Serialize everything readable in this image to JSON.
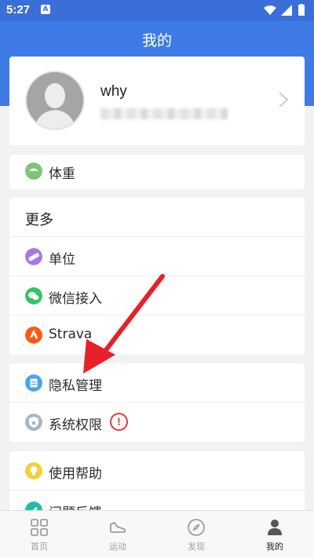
{
  "status_bar": {
    "time": "5:27",
    "notif_letter": "A"
  },
  "header": {
    "title": "我的"
  },
  "profile": {
    "username": "why",
    "avatar_icon": "avatar-placeholder-icon"
  },
  "weight_section": {
    "label": "体重",
    "icon": "scale-icon",
    "icon_color": "#7cc576"
  },
  "more_section": {
    "title": "更多",
    "items": [
      {
        "label": "单位",
        "icon": "ruler-icon",
        "icon_color": "#a678e6"
      },
      {
        "label": "微信接入",
        "icon": "wechat-icon",
        "icon_color": "#35c45f"
      },
      {
        "label": "Strava",
        "icon": "strava-icon",
        "icon_color": "#fc5a12"
      }
    ]
  },
  "privacy_section": {
    "items": [
      {
        "label": "隐私管理",
        "icon": "document-icon",
        "icon_color": "#4aa3f0"
      },
      {
        "label": "系统权限",
        "icon": "lock-shield-icon",
        "icon_color": "#a7b4c8",
        "warning": "!"
      }
    ]
  },
  "help_section": {
    "items": [
      {
        "label": "使用帮助",
        "icon": "lightbulb-icon",
        "icon_color": "#f3cf3a"
      },
      {
        "label": "问题反馈",
        "icon": "edit-icon",
        "icon_color": "#1fbfa6"
      }
    ]
  },
  "bottom_nav": {
    "items": [
      {
        "label": "首页",
        "icon": "grid-icon"
      },
      {
        "label": "运动",
        "icon": "shoe-icon"
      },
      {
        "label": "发现",
        "icon": "compass-icon"
      },
      {
        "label": "我的",
        "icon": "person-icon",
        "active": true
      }
    ]
  },
  "annotation_arrow_color": "#e8202a"
}
